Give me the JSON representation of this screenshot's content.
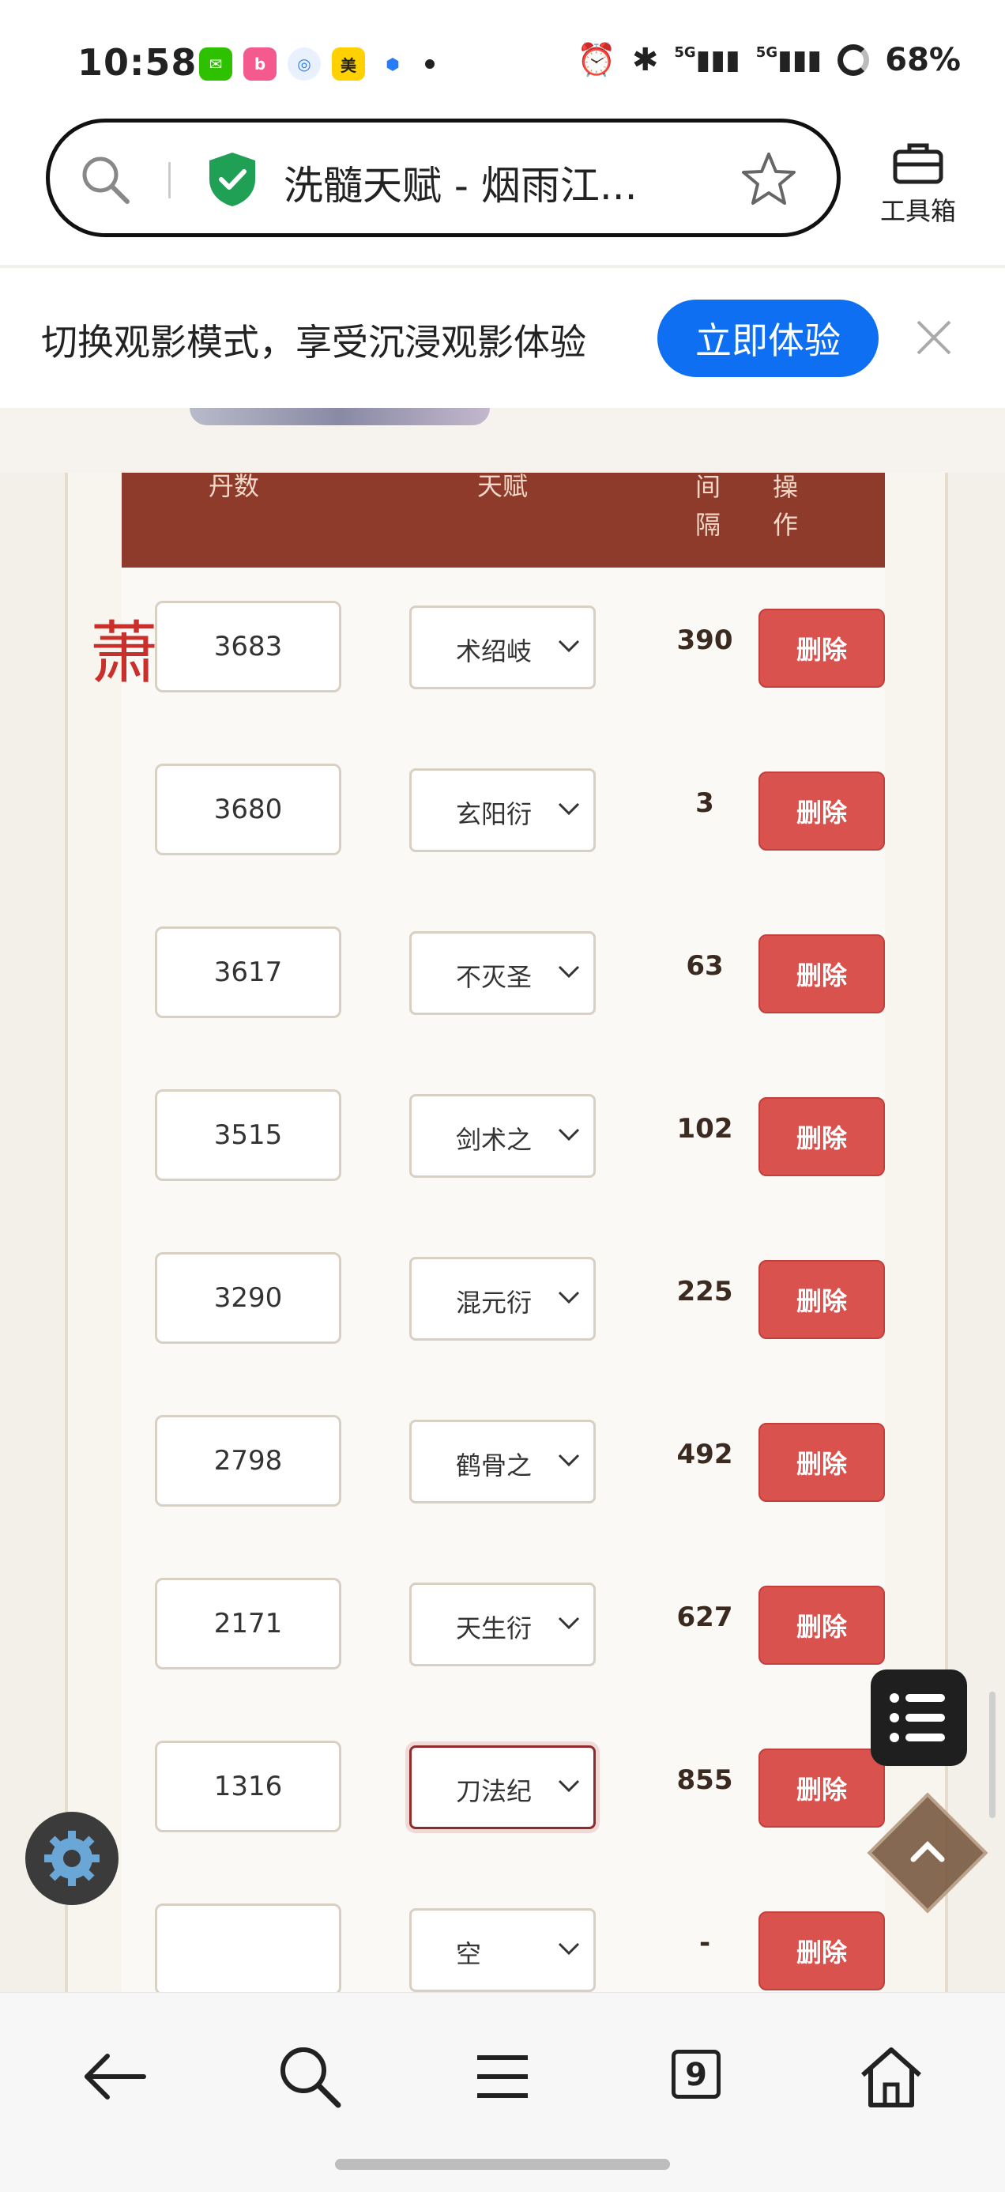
{
  "status_bar": {
    "time": "10:58",
    "network": "5G",
    "battery": "68%",
    "app_icons": [
      "wechat-icon",
      "bilibili-icon",
      "browser-icon",
      "meituan-icon",
      "map-icon"
    ]
  },
  "address_bar": {
    "title": "洗髓天赋 - 烟雨江...",
    "toolbox_label": "工具箱"
  },
  "banner": {
    "text": "切换观影模式，享受沉浸观影体验",
    "button": "立即体验"
  },
  "page": {
    "seal_char": "萧",
    "table": {
      "headers": {
        "dan": "丹数",
        "talent": "天赋",
        "gap": "间隔",
        "op": "操作"
      },
      "delete_label": "删除",
      "rows": [
        {
          "dan": "3683",
          "talent": "术绍岐",
          "gap": "390"
        },
        {
          "dan": "3680",
          "talent": "玄阳衍",
          "gap": "3"
        },
        {
          "dan": "3617",
          "talent": "不灭圣",
          "gap": "63"
        },
        {
          "dan": "3515",
          "talent": "剑术之",
          "gap": "102"
        },
        {
          "dan": "3290",
          "talent": "混元衍",
          "gap": "225"
        },
        {
          "dan": "2798",
          "talent": "鹤骨之",
          "gap": "492"
        },
        {
          "dan": "2171",
          "talent": "天生衍",
          "gap": "627"
        },
        {
          "dan": "1316",
          "talent": "刀法纪",
          "gap": "855"
        },
        {
          "dan": "",
          "talent": "空",
          "gap": "-"
        }
      ]
    }
  },
  "bottom_nav": {
    "tab_count": "9"
  },
  "colors": {
    "header_bg": "#8e3b2b",
    "delete_btn": "#d9524e",
    "banner_btn": "#0f6ff2"
  }
}
